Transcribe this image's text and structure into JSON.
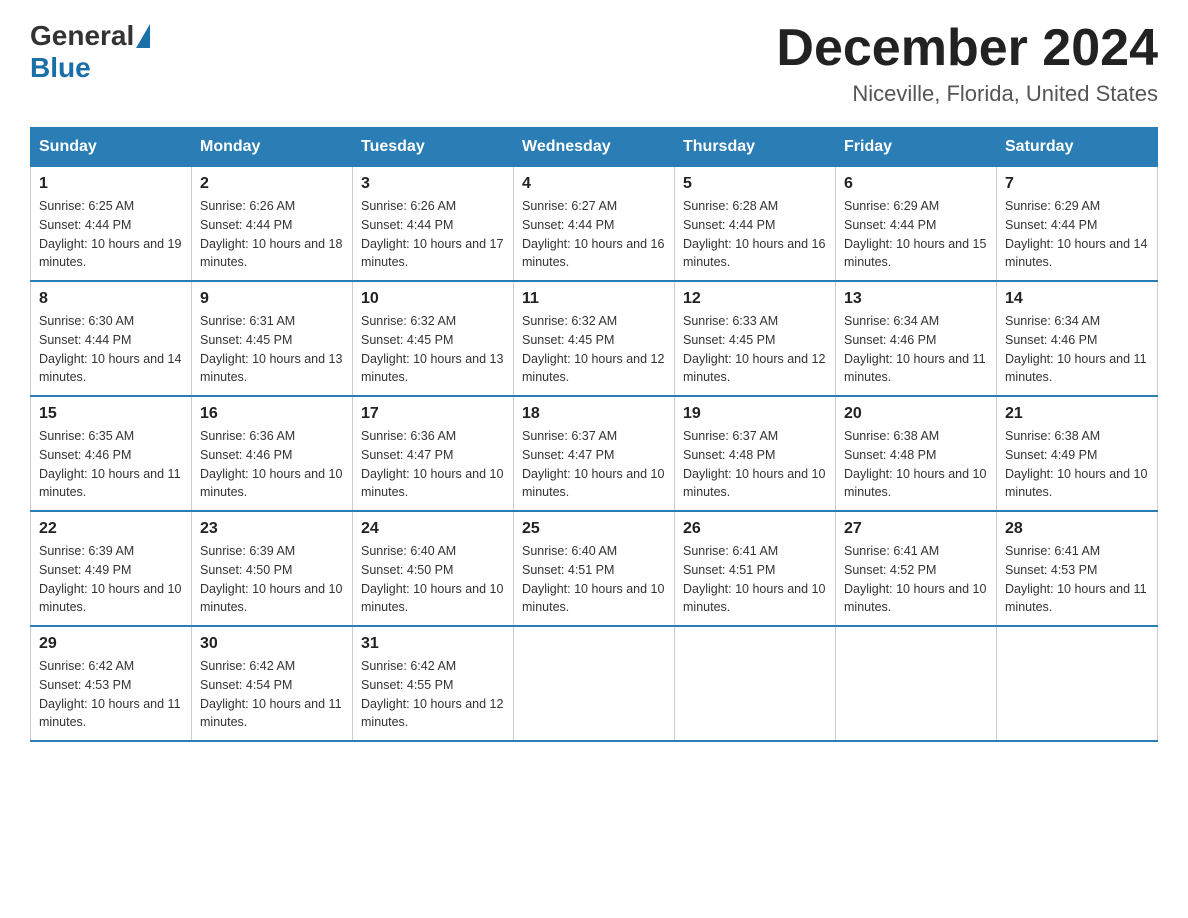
{
  "logo": {
    "general": "General",
    "blue": "Blue"
  },
  "title": "December 2024",
  "subtitle": "Niceville, Florida, United States",
  "weekdays": [
    "Sunday",
    "Monday",
    "Tuesday",
    "Wednesday",
    "Thursday",
    "Friday",
    "Saturday"
  ],
  "weeks": [
    [
      {
        "day": "1",
        "sunrise": "6:25 AM",
        "sunset": "4:44 PM",
        "daylight": "10 hours and 19 minutes."
      },
      {
        "day": "2",
        "sunrise": "6:26 AM",
        "sunset": "4:44 PM",
        "daylight": "10 hours and 18 minutes."
      },
      {
        "day": "3",
        "sunrise": "6:26 AM",
        "sunset": "4:44 PM",
        "daylight": "10 hours and 17 minutes."
      },
      {
        "day": "4",
        "sunrise": "6:27 AM",
        "sunset": "4:44 PM",
        "daylight": "10 hours and 16 minutes."
      },
      {
        "day": "5",
        "sunrise": "6:28 AM",
        "sunset": "4:44 PM",
        "daylight": "10 hours and 16 minutes."
      },
      {
        "day": "6",
        "sunrise": "6:29 AM",
        "sunset": "4:44 PM",
        "daylight": "10 hours and 15 minutes."
      },
      {
        "day": "7",
        "sunrise": "6:29 AM",
        "sunset": "4:44 PM",
        "daylight": "10 hours and 14 minutes."
      }
    ],
    [
      {
        "day": "8",
        "sunrise": "6:30 AM",
        "sunset": "4:44 PM",
        "daylight": "10 hours and 14 minutes."
      },
      {
        "day": "9",
        "sunrise": "6:31 AM",
        "sunset": "4:45 PM",
        "daylight": "10 hours and 13 minutes."
      },
      {
        "day": "10",
        "sunrise": "6:32 AM",
        "sunset": "4:45 PM",
        "daylight": "10 hours and 13 minutes."
      },
      {
        "day": "11",
        "sunrise": "6:32 AM",
        "sunset": "4:45 PM",
        "daylight": "10 hours and 12 minutes."
      },
      {
        "day": "12",
        "sunrise": "6:33 AM",
        "sunset": "4:45 PM",
        "daylight": "10 hours and 12 minutes."
      },
      {
        "day": "13",
        "sunrise": "6:34 AM",
        "sunset": "4:46 PM",
        "daylight": "10 hours and 11 minutes."
      },
      {
        "day": "14",
        "sunrise": "6:34 AM",
        "sunset": "4:46 PM",
        "daylight": "10 hours and 11 minutes."
      }
    ],
    [
      {
        "day": "15",
        "sunrise": "6:35 AM",
        "sunset": "4:46 PM",
        "daylight": "10 hours and 11 minutes."
      },
      {
        "day": "16",
        "sunrise": "6:36 AM",
        "sunset": "4:46 PM",
        "daylight": "10 hours and 10 minutes."
      },
      {
        "day": "17",
        "sunrise": "6:36 AM",
        "sunset": "4:47 PM",
        "daylight": "10 hours and 10 minutes."
      },
      {
        "day": "18",
        "sunrise": "6:37 AM",
        "sunset": "4:47 PM",
        "daylight": "10 hours and 10 minutes."
      },
      {
        "day": "19",
        "sunrise": "6:37 AM",
        "sunset": "4:48 PM",
        "daylight": "10 hours and 10 minutes."
      },
      {
        "day": "20",
        "sunrise": "6:38 AM",
        "sunset": "4:48 PM",
        "daylight": "10 hours and 10 minutes."
      },
      {
        "day": "21",
        "sunrise": "6:38 AM",
        "sunset": "4:49 PM",
        "daylight": "10 hours and 10 minutes."
      }
    ],
    [
      {
        "day": "22",
        "sunrise": "6:39 AM",
        "sunset": "4:49 PM",
        "daylight": "10 hours and 10 minutes."
      },
      {
        "day": "23",
        "sunrise": "6:39 AM",
        "sunset": "4:50 PM",
        "daylight": "10 hours and 10 minutes."
      },
      {
        "day": "24",
        "sunrise": "6:40 AM",
        "sunset": "4:50 PM",
        "daylight": "10 hours and 10 minutes."
      },
      {
        "day": "25",
        "sunrise": "6:40 AM",
        "sunset": "4:51 PM",
        "daylight": "10 hours and 10 minutes."
      },
      {
        "day": "26",
        "sunrise": "6:41 AM",
        "sunset": "4:51 PM",
        "daylight": "10 hours and 10 minutes."
      },
      {
        "day": "27",
        "sunrise": "6:41 AM",
        "sunset": "4:52 PM",
        "daylight": "10 hours and 10 minutes."
      },
      {
        "day": "28",
        "sunrise": "6:41 AM",
        "sunset": "4:53 PM",
        "daylight": "10 hours and 11 minutes."
      }
    ],
    [
      {
        "day": "29",
        "sunrise": "6:42 AM",
        "sunset": "4:53 PM",
        "daylight": "10 hours and 11 minutes."
      },
      {
        "day": "30",
        "sunrise": "6:42 AM",
        "sunset": "4:54 PM",
        "daylight": "10 hours and 11 minutes."
      },
      {
        "day": "31",
        "sunrise": "6:42 AM",
        "sunset": "4:55 PM",
        "daylight": "10 hours and 12 minutes."
      },
      null,
      null,
      null,
      null
    ]
  ]
}
